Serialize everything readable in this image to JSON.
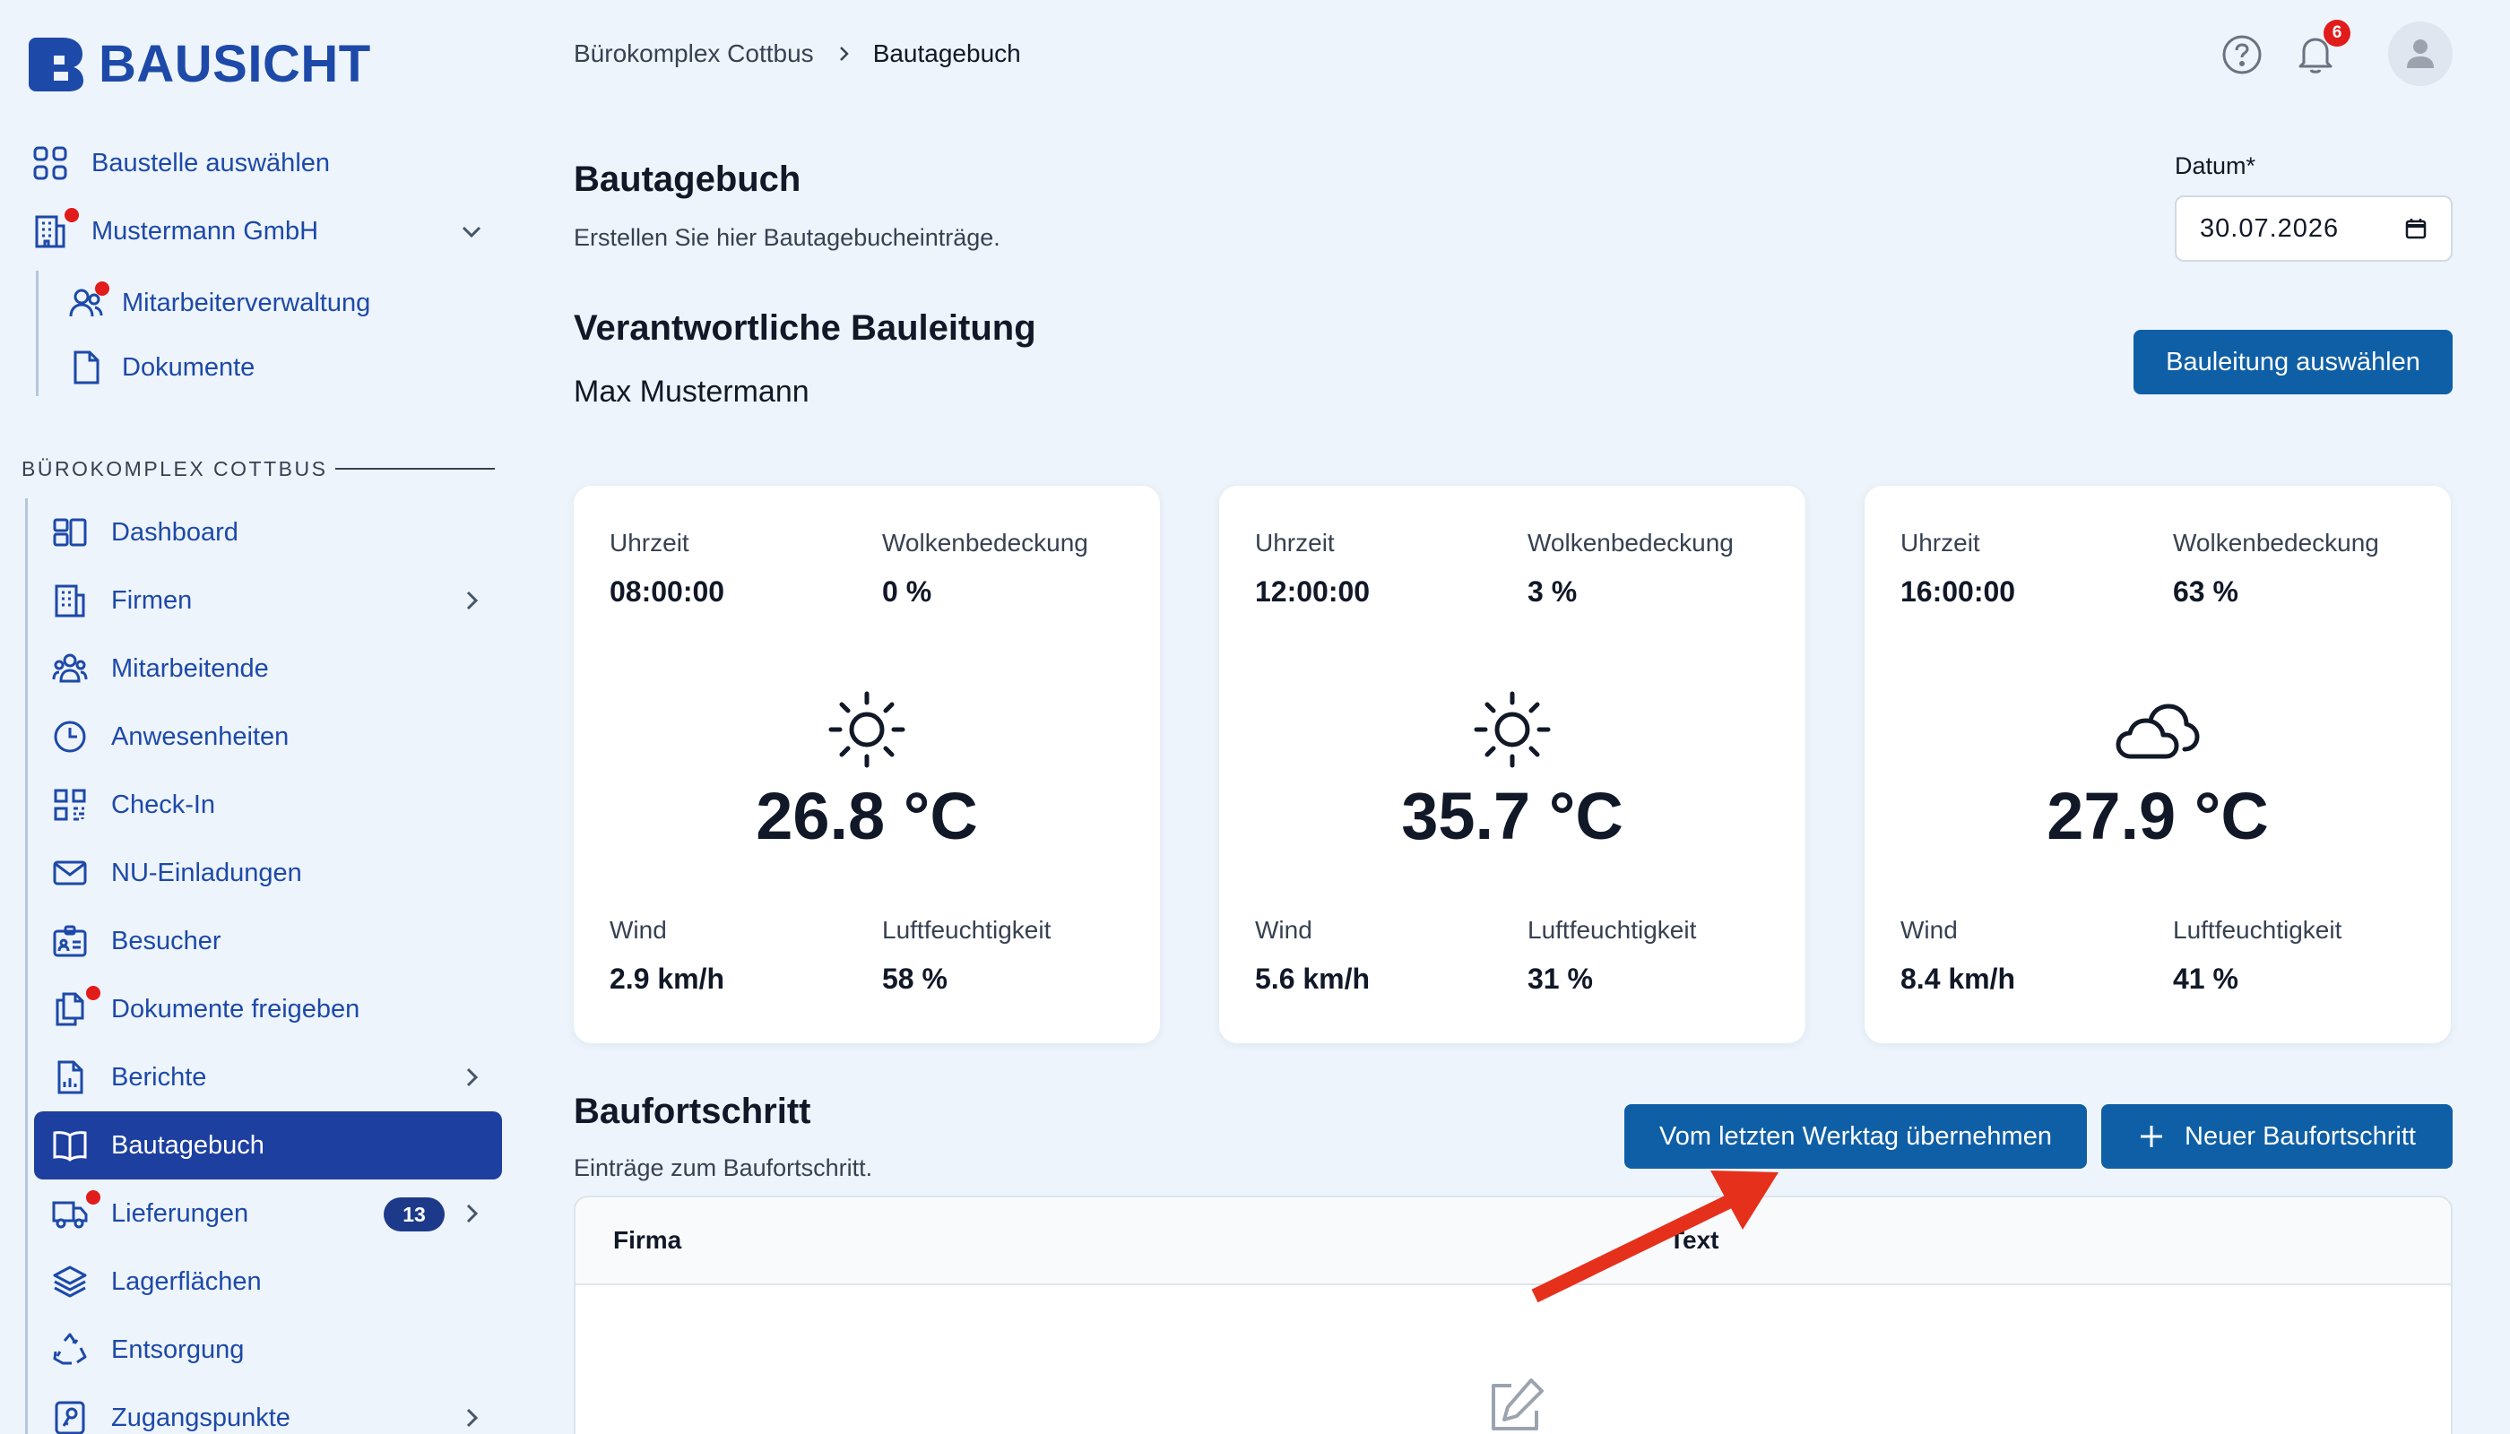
{
  "brand": {
    "name": "BAUSICHT"
  },
  "sidebar": {
    "top_items": [
      {
        "label": "Baustelle auswählen",
        "icon": "grid-icon"
      },
      {
        "label": "Mustermann GmbH",
        "icon": "building-icon"
      }
    ],
    "company_items": [
      {
        "label": "Mitarbeiterverwaltung",
        "icon": "users-icon"
      },
      {
        "label": "Dokumente",
        "icon": "document-icon"
      }
    ],
    "section_title": "BÜROKOMPLEX COTTBUS",
    "items": [
      {
        "label": "Dashboard",
        "icon": "dashboard-icon"
      },
      {
        "label": "Firmen",
        "icon": "building-icon"
      },
      {
        "label": "Mitarbeitende",
        "icon": "people-icon"
      },
      {
        "label": "Anwesenheiten",
        "icon": "clock-icon"
      },
      {
        "label": "Check-In",
        "icon": "qr-code-icon"
      },
      {
        "label": "NU-Einladungen",
        "icon": "envelope-icon"
      },
      {
        "label": "Besucher",
        "icon": "id-card-icon"
      },
      {
        "label": "Dokumente freigeben",
        "icon": "documents-icon"
      },
      {
        "label": "Berichte",
        "icon": "report-icon"
      },
      {
        "label": "Bautagebuch",
        "icon": "book-icon"
      },
      {
        "label": "Lieferungen",
        "icon": "truck-icon",
        "badge": "13"
      },
      {
        "label": "Lagerflächen",
        "icon": "layers-icon"
      },
      {
        "label": "Entsorgung",
        "icon": "recycle-icon"
      },
      {
        "label": "Zugangspunkte",
        "icon": "key-icon"
      }
    ]
  },
  "header": {
    "breadcrumb": [
      "Bürokomplex Cottbus",
      "Bautagebuch"
    ],
    "notification_count": "6"
  },
  "page": {
    "title": "Bautagebuch",
    "subtitle": "Erstellen Sie hier Bautagebucheinträge.",
    "date_label": "Datum*",
    "date_value": "30.07.2026",
    "responsible_title": "Verantwortliche Bauleitung",
    "responsible_name": "Max Mustermann",
    "select_lead_button": "Bauleitung auswählen"
  },
  "weather_labels": {
    "time": "Uhrzeit",
    "clouds": "Wolkenbedeckung",
    "wind": "Wind",
    "humidity": "Luftfeuchtigkeit"
  },
  "weather": [
    {
      "time": "08:00:00",
      "clouds": "0 %",
      "icon": "sun-icon",
      "temp": "26.8 °C",
      "wind": "2.9 km/h",
      "humidity": "58 %"
    },
    {
      "time": "12:00:00",
      "clouds": "3 %",
      "icon": "sun-icon",
      "temp": "35.7 °C",
      "wind": "5.6 km/h",
      "humidity": "31 %"
    },
    {
      "time": "16:00:00",
      "clouds": "63 %",
      "icon": "cloud-icon",
      "temp": "27.9 °C",
      "wind": "8.4 km/h",
      "humidity": "41 %"
    }
  ],
  "progress": {
    "title": "Baufortschritt",
    "subtitle": "Einträge zum Baufortschritt.",
    "copy_button": "Vom letzten Werktag übernehmen",
    "new_button": "Neuer Baufortschritt",
    "columns": [
      "Firma",
      "Text"
    ],
    "empty_icon": "edit-icon"
  },
  "colors": {
    "brand_blue": "#1d49a8",
    "active_nav": "#1d3fa0",
    "button_blue": "#0f5fa6",
    "alert_red": "#e21b1b",
    "annotation_arrow": "#e5311c"
  }
}
